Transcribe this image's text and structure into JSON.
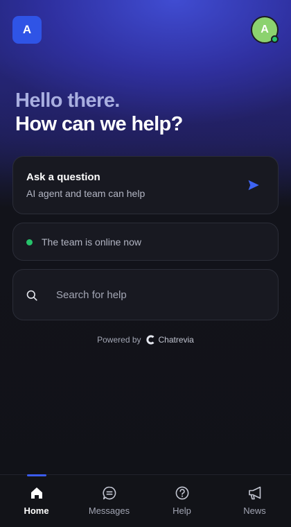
{
  "header": {
    "logo_letter": "A",
    "avatar_letter": "A",
    "avatar_status": "online",
    "avatar_color": "#8cd26f"
  },
  "greeting": {
    "line1": "Hello there.",
    "line2": "How can we help?"
  },
  "ask_card": {
    "title": "Ask a question",
    "subtitle": "AI agent and team can help",
    "icon": "send-icon"
  },
  "status": {
    "text": "The team is online now",
    "color": "#26c26a"
  },
  "search": {
    "placeholder": "Search for help",
    "value": ""
  },
  "footer": {
    "powered_by": "Powered by",
    "brand": "Chatrevia"
  },
  "nav": {
    "items": [
      {
        "label": "Home",
        "icon": "home-icon",
        "active": true
      },
      {
        "label": "Messages",
        "icon": "messages-icon",
        "active": false
      },
      {
        "label": "Help",
        "icon": "help-icon",
        "active": false
      },
      {
        "label": "News",
        "icon": "megaphone-icon",
        "active": false
      }
    ]
  },
  "colors": {
    "accent": "#2f54e6",
    "background": "#111218",
    "card": "#181921"
  }
}
